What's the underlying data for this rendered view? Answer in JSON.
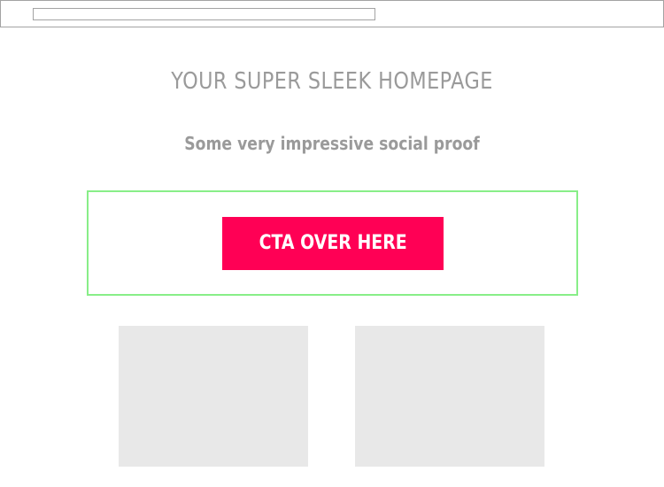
{
  "browser": {
    "address_value": ""
  },
  "hero": {
    "headline": "YOUR SUPER SLEEK HOMEPAGE",
    "social_proof": "Some very impressive social proof"
  },
  "cta": {
    "label": "CTA OVER HERE",
    "color": "#ff0055",
    "region_border_color": "#88ee88"
  },
  "colors": {
    "text_gray": "#9a9a9a",
    "placeholder_fill": "#e8e8e8",
    "chrome_border": "#a3a3a3"
  }
}
